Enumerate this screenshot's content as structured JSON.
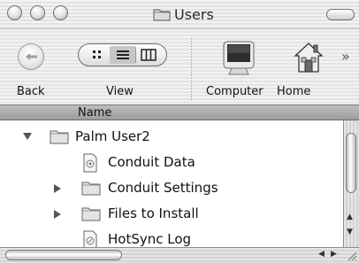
{
  "window": {
    "title": "Users",
    "title_icon": "folder-icon"
  },
  "toolbar": {
    "back_label": "Back",
    "view_label": "View",
    "view_modes": [
      {
        "name": "icon-view",
        "selected": false
      },
      {
        "name": "list-view",
        "selected": true
      },
      {
        "name": "column-view",
        "selected": false
      }
    ],
    "computer_label": "Computer",
    "home_label": "Home",
    "overflow_icon": "double-chevron-right-icon"
  },
  "columns": {
    "name_label": "Name"
  },
  "rows": [
    {
      "label": "Palm User2",
      "icon": "folder-icon",
      "disclosure": "expanded"
    },
    {
      "label": "Conduit Data",
      "icon": "document-icon",
      "disclosure": "none"
    },
    {
      "label": "Conduit Settings",
      "icon": "folder-icon",
      "disclosure": "collapsed"
    },
    {
      "label": "Files to Install",
      "icon": "folder-icon",
      "disclosure": "collapsed"
    },
    {
      "label": "HotSync Log",
      "icon": "document-icon",
      "disclosure": "none"
    }
  ]
}
